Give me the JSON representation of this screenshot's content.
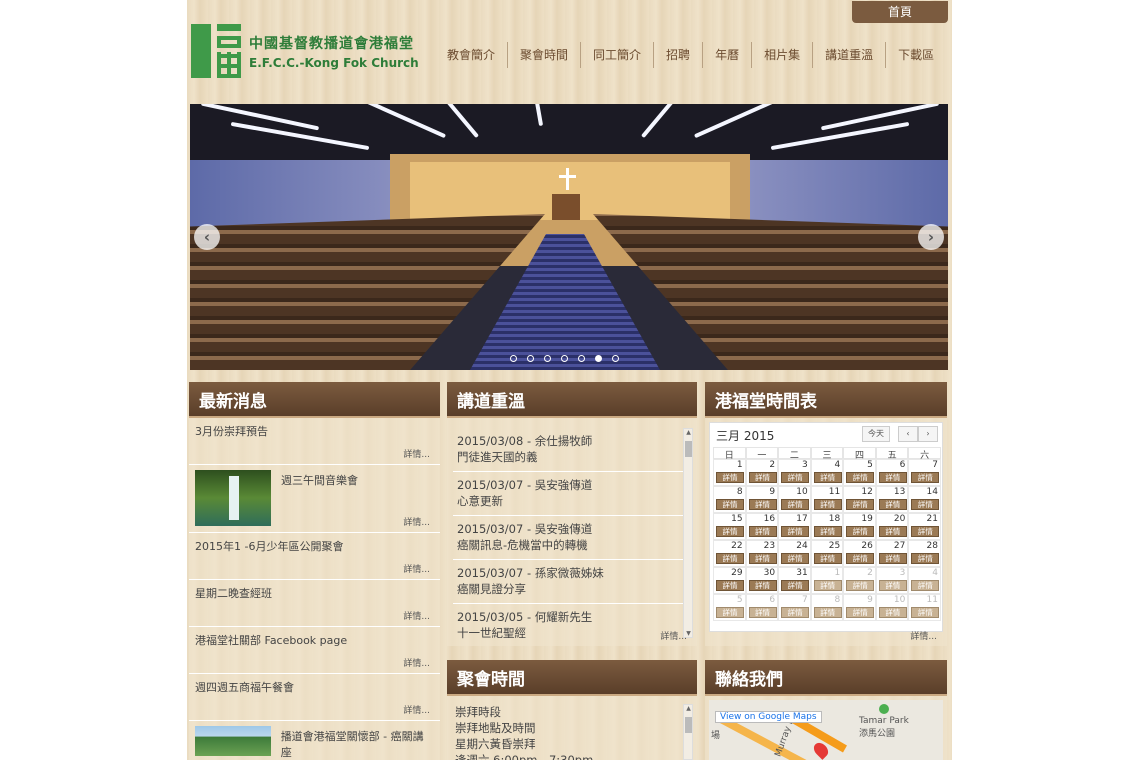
{
  "header": {
    "home_tab": "首頁",
    "logo_zh": "中國基督教播道會港福堂",
    "logo_en": "E.F.C.C.-Kong Fok Church",
    "nav": [
      "教會簡介",
      "聚會時間",
      "同工簡介",
      "招聘",
      "年曆",
      "相片集",
      "講道重溫",
      "下載區"
    ]
  },
  "slider": {
    "prev": "‹",
    "next": "›",
    "slide_count": 7,
    "active_slide": 6
  },
  "news": {
    "title": "最新消息",
    "more_label": "詳情...",
    "items": [
      {
        "text": "3月份崇拜預告",
        "image": ""
      },
      {
        "text": "週三午間音樂會",
        "image": "waterfall"
      },
      {
        "text": "2015年1 -6月少年區公開聚會",
        "image": ""
      },
      {
        "text": "星期二晚查經班",
        "image": ""
      },
      {
        "text": "港福堂社關部 Facebook page",
        "image": ""
      },
      {
        "text": "週四週五商福午餐會",
        "image": ""
      },
      {
        "text": "播道會港福堂關懷部 - 癌關講座",
        "image": "mountain"
      }
    ]
  },
  "sermons": {
    "title": "講道重溫",
    "more_label": "詳情...",
    "items": [
      {
        "line1": "2015/03/08 - 余仕揚牧師",
        "line2": "門徒進天國的義"
      },
      {
        "line1": "2015/03/07 - 吳安強傳道",
        "line2": "心意更新"
      },
      {
        "line1": "2015/03/07 - 吳安強傳道",
        "line2": "癌關訊息-危機當中的轉機"
      },
      {
        "line1": "2015/03/07 - 孫家微薇姊妹",
        "line2": "癌關見證分享"
      },
      {
        "line1": "2015/03/05 - 何耀新先生",
        "line2": "十一世紀聖經"
      }
    ]
  },
  "calendar": {
    "title": "港福堂時間表",
    "month_label": "三月 2015",
    "today_label": "今天",
    "prev": "‹",
    "next": "›",
    "event_label": "詳情",
    "weekdays": [
      "日",
      "一",
      "二",
      "三",
      "四",
      "五",
      "六"
    ],
    "weeks": [
      [
        {
          "d": "1",
          "o": false
        },
        {
          "d": "2",
          "o": false
        },
        {
          "d": "3",
          "o": false
        },
        {
          "d": "4",
          "o": false
        },
        {
          "d": "5",
          "o": false
        },
        {
          "d": "6",
          "o": false
        },
        {
          "d": "7",
          "o": false
        }
      ],
      [
        {
          "d": "8",
          "o": false
        },
        {
          "d": "9",
          "o": false
        },
        {
          "d": "10",
          "o": false
        },
        {
          "d": "11",
          "o": false
        },
        {
          "d": "12",
          "o": false
        },
        {
          "d": "13",
          "o": false
        },
        {
          "d": "14",
          "o": false
        }
      ],
      [
        {
          "d": "15",
          "o": false
        },
        {
          "d": "16",
          "o": false
        },
        {
          "d": "17",
          "o": false
        },
        {
          "d": "18",
          "o": false
        },
        {
          "d": "19",
          "o": false
        },
        {
          "d": "20",
          "o": false
        },
        {
          "d": "21",
          "o": false
        }
      ],
      [
        {
          "d": "22",
          "o": false
        },
        {
          "d": "23",
          "o": false
        },
        {
          "d": "24",
          "o": false
        },
        {
          "d": "25",
          "o": false
        },
        {
          "d": "26",
          "o": false
        },
        {
          "d": "27",
          "o": false
        },
        {
          "d": "28",
          "o": false
        }
      ],
      [
        {
          "d": "29",
          "o": false
        },
        {
          "d": "30",
          "o": false
        },
        {
          "d": "31",
          "o": false
        },
        {
          "d": "1",
          "o": true
        },
        {
          "d": "2",
          "o": true
        },
        {
          "d": "3",
          "o": true
        },
        {
          "d": "4",
          "o": true
        }
      ],
      [
        {
          "d": "5",
          "o": true
        },
        {
          "d": "6",
          "o": true
        },
        {
          "d": "7",
          "o": true
        },
        {
          "d": "8",
          "o": true
        },
        {
          "d": "9",
          "o": true
        },
        {
          "d": "10",
          "o": true
        },
        {
          "d": "11",
          "o": true
        }
      ]
    ],
    "more_label": "詳情..."
  },
  "meetings": {
    "title": "聚會時間",
    "lines": [
      "崇拜時段",
      "崇拜地點及時間",
      "星期六黃昏崇拜",
      "逢週六 6:00pm - 7:30pm"
    ]
  },
  "contact": {
    "title": "聯絡我們",
    "map_link": "View on Google Maps",
    "label_park": "Tamar Park",
    "label_park_zh": "添馬公園",
    "label_left": "場",
    "label_road": "Murray Ro"
  }
}
